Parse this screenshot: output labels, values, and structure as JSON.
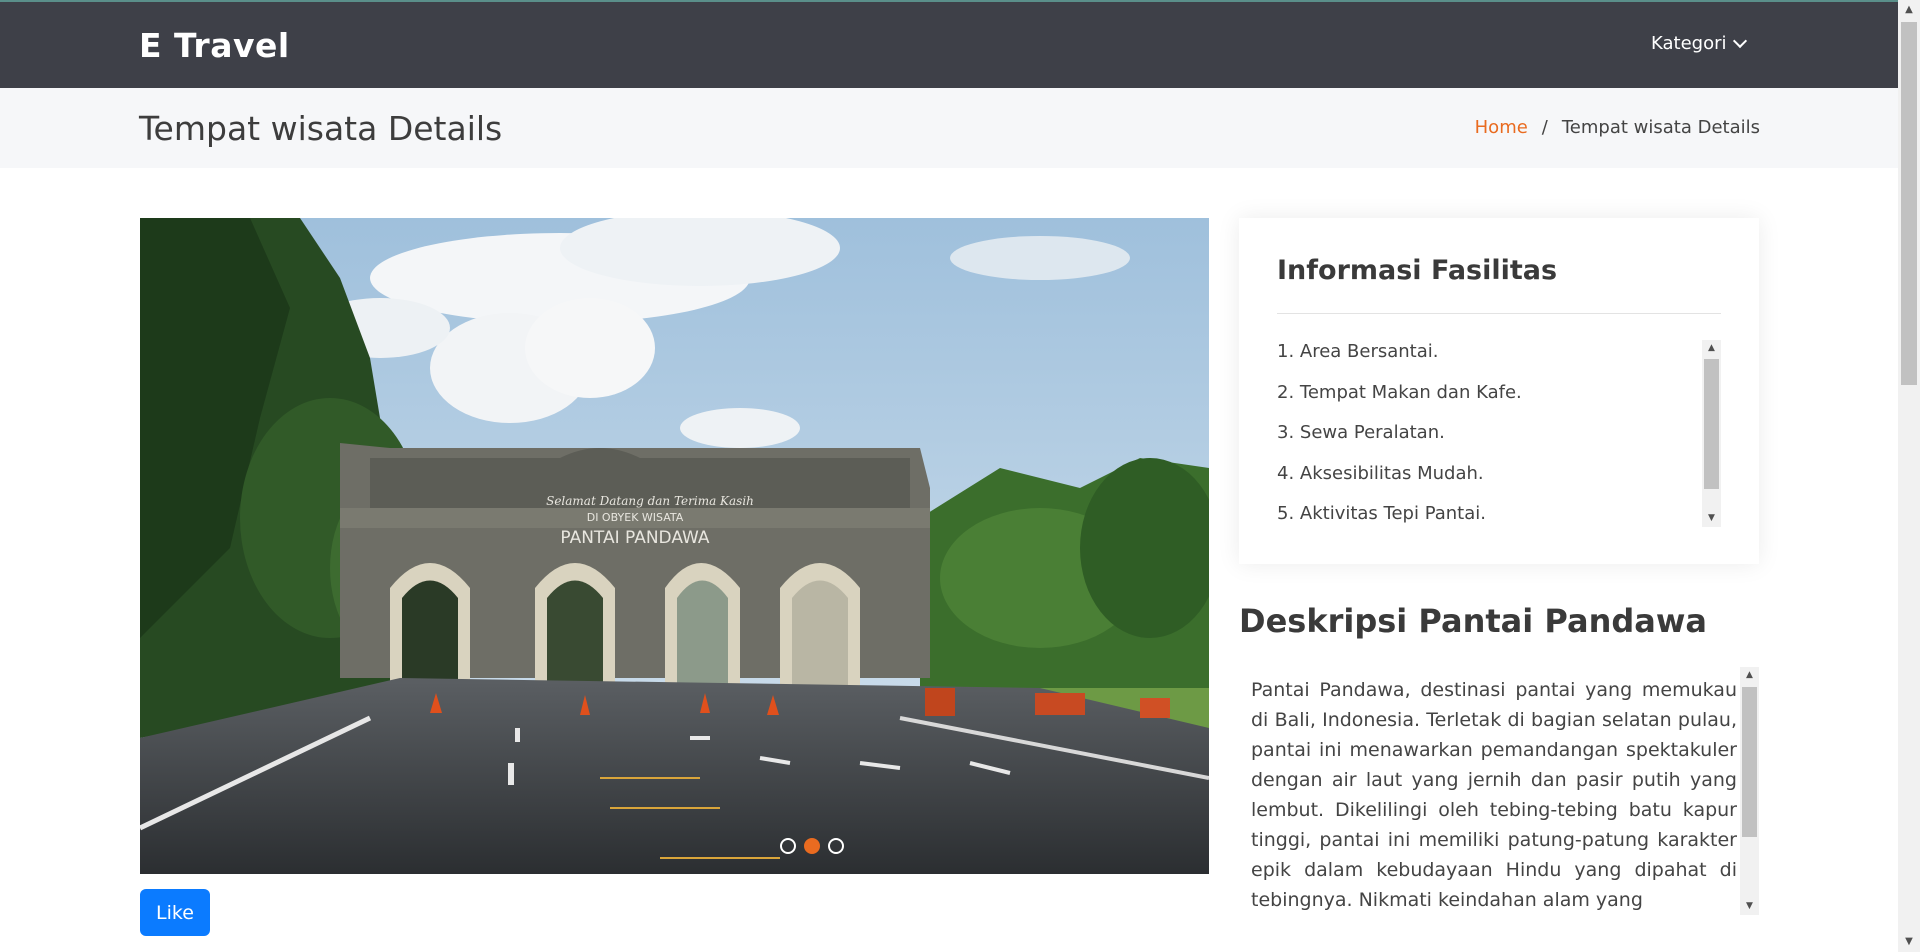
{
  "header": {
    "logo": "E Travel",
    "nav_kategori": "Kategori"
  },
  "breadcrumb_bar": {
    "page_title": "Tempat wisata Details",
    "home": "Home",
    "separator": "/",
    "current": "Tempat wisata Details"
  },
  "carousel": {
    "sign_line1": "Selamat Datang dan Terima Kasih",
    "sign_line2": "DI OBYEK WISATA",
    "sign_line3": "PANTAI PANDAWA",
    "slide_count": 3,
    "active_slide": 2
  },
  "like_button": "Like",
  "facilities": {
    "title": "Informasi Fasilitas",
    "items": [
      "1. Area Bersantai.",
      "2. Tempat Makan dan Kafe.",
      "3. Sewa Peralatan.",
      "4. Aksesibilitas Mudah.",
      "5. Aktivitas Tepi Pantai."
    ]
  },
  "description": {
    "title": "Deskripsi Pantai Pandawa",
    "text": "Pantai Pandawa, destinasi pantai yang memukau di Bali, Indonesia. Terletak di bagian selatan pulau, pantai ini menawarkan pemandangan spektakuler dengan air laut yang jernih dan pasir putih yang lembut. Dikelilingi oleh tebing-tebing batu kapur tinggi, pantai ini memiliki patung-patung karakter epik dalam kebudayaan Hindu yang dipahat di tebingnya. Nikmati keindahan alam yang"
  },
  "colors": {
    "header_bg": "#3e4048",
    "accent_orange": "#e96b20",
    "like_blue": "#0b7bff"
  }
}
